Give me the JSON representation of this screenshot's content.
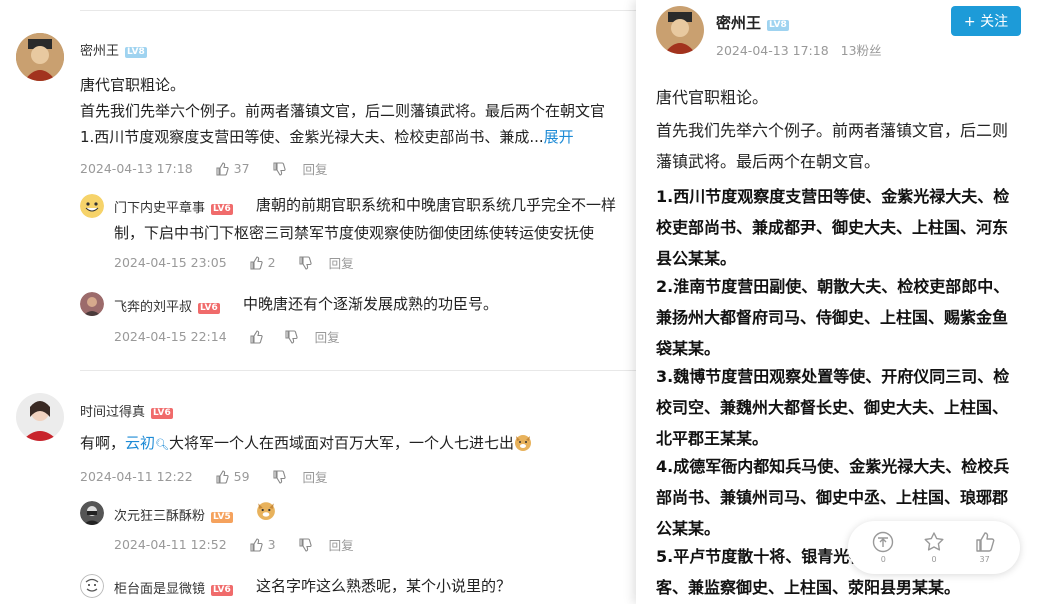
{
  "comments": [
    {
      "user": "密州王",
      "level": "LV8",
      "lines": [
        "唐代官职粗论。",
        "首先我们先举六个例子。前两者藩镇文官，后二则藩镇武将。最后两个在朝文官",
        " 1.西川节度观察度支营田等使、金紫光禄大夫、检校吏部尚书、兼成..."
      ],
      "expand": "展开",
      "time": "2024-04-13 17:18",
      "likes": "37",
      "reply": "回复"
    },
    {
      "user": "门下内史平章事",
      "level": "LV6",
      "lines": [
        "唐朝的前期官职系统和中晚唐官职系统几乎完全不一样",
        "制，下启中书门下枢密三司禁军节度使观察使防御使团练使转运使安抚使"
      ],
      "time": "2024-04-15 23:05",
      "likes": "2",
      "reply": "回复"
    },
    {
      "user": "飞奔的刘平叔",
      "level": "LV6",
      "text": "中晚唐还有个逐渐发展成熟的功臣号。",
      "time": "2024-04-15 22:14",
      "reply": "回复"
    },
    {
      "user": "时间过得真",
      "level": "LV6",
      "text_pre": "有啊，",
      "mention": "云初",
      "text_post": "大将军一个人在西域面对百万大军，一个人七进七出",
      "time": "2024-04-11 12:22",
      "likes": "59",
      "reply": "回复"
    },
    {
      "user": "次元狂三酥酥粉",
      "level": "LV5",
      "time": "2024-04-11 12:52",
      "likes": "3",
      "reply": "回复"
    },
    {
      "user": "柜台面是显微镜",
      "level": "LV6",
      "text": "这名字咋这么熟悉呢，某个小说里的？"
    }
  ],
  "panel": {
    "user": "密州王",
    "level": "LV8",
    "time": "2024-04-13 17:18",
    "fans": "13粉丝",
    "follow": "+ 关注",
    "p1": "唐代官职粗论。",
    "p2": "首先我们先举六个例子。前两者藩镇文官，后二则藩镇武将。最后两个在朝文官。",
    "b1": " 1.西川节度观察度支营田等使、金紫光禄大夫、检校吏部尚书、兼成都尹、御史大夫、上柱国、河东县公某某。",
    "b2": "2.淮南节度营田副使、朝散大夫、检校吏部郎中、兼扬州大都督府司马、侍御史、上柱国、赐紫金鱼袋某某。",
    "b3": "3.魏博节度营田观察处置等使、开府仪同三司、检校司空、兼魏州大都督长史、御史大夫、上柱国、北平郡王某某。",
    "b4": "4.成德军衙内都知兵马使、金紫光禄大夫、检校兵部尚书、兼镇州司马、御史中丞、上柱国、琅琊郡公某某。",
    "b5": "5.平卢节度散十将、银青光禄大夫、检校太子宾客、兼监察御史、上柱国、荥阳县男某某。",
    "stats": {
      "share": "0",
      "fav": "0",
      "like": "37"
    }
  }
}
